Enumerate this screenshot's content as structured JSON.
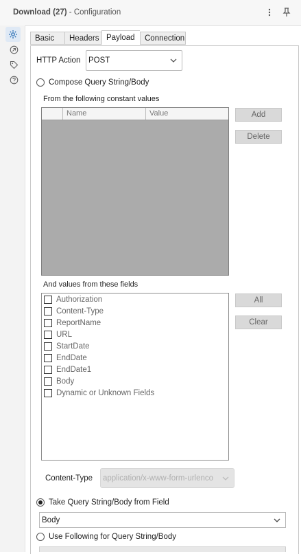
{
  "header": {
    "title_main": "Download (27)",
    "title_sub": " - Configuration",
    "menu_icon": "more-vertical-icon",
    "pin_icon": "pin-icon"
  },
  "rail": [
    {
      "icon": "gear-icon",
      "active": true
    },
    {
      "icon": "arrow-circle-icon",
      "active": false
    },
    {
      "icon": "tag-icon",
      "active": false
    },
    {
      "icon": "help-icon",
      "active": false
    }
  ],
  "tabs": [
    {
      "label": "Basic",
      "active": false
    },
    {
      "label": "Headers",
      "active": false
    },
    {
      "label": "Payload",
      "active": true
    },
    {
      "label": "Connection",
      "active": false
    }
  ],
  "http_action": {
    "label": "HTTP Action",
    "value": "POST"
  },
  "compose": {
    "label": "Compose Query String/Body",
    "checked": false,
    "constants_label": "From the following constant values",
    "columns": [
      "Name",
      "Value"
    ],
    "add_label": "Add",
    "delete_label": "Delete",
    "fields_label": "And values from these fields",
    "fields": [
      "Authorization",
      "Content-Type",
      "ReportName",
      "URL",
      "StartDate",
      "EndDate",
      "EndDate1",
      "Body",
      "Dynamic or Unknown Fields"
    ],
    "all_label": "All",
    "clear_label": "Clear",
    "content_type_label": "Content-Type",
    "content_type_value": "application/x-www-form-urlenco"
  },
  "take_from_field": {
    "label": "Take Query String/Body from Field",
    "checked": true,
    "value": "Body"
  },
  "use_following": {
    "label": "Use Following for Query String/Body",
    "checked": false
  }
}
